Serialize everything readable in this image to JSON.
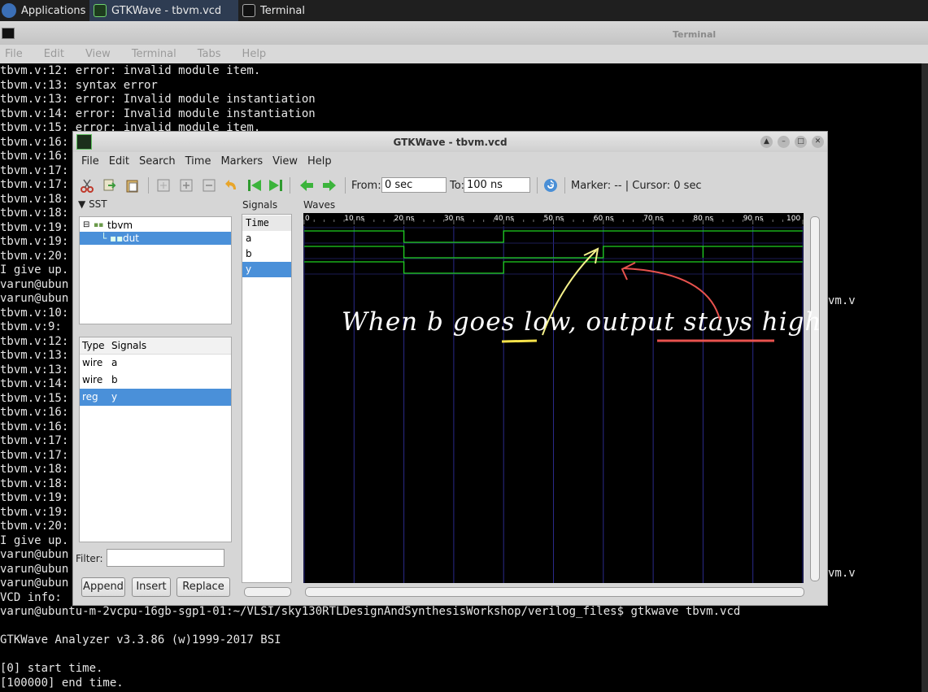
{
  "taskbar": {
    "applications": "Applications",
    "gtkwave_task": "GTKWave - tbvm.vcd",
    "terminal_task": "Terminal"
  },
  "terminal": {
    "title": "Terminal",
    "menu": [
      "File",
      "Edit",
      "View",
      "Terminal",
      "Tabs",
      "Help"
    ],
    "lines": [
      "tbvm.v:12: error: invalid module item.",
      "tbvm.v:13: syntax error",
      "tbvm.v:13: error: Invalid module instantiation",
      "tbvm.v:14: error: Invalid module instantiation",
      "tbvm.v:15: error: invalid module item.",
      "tbvm.v:16:",
      "tbvm.v:16:",
      "tbvm.v:17:",
      "tbvm.v:17:",
      "tbvm.v:18:",
      "tbvm.v:18:",
      "tbvm.v:19:",
      "tbvm.v:19:",
      "tbvm.v:20:",
      "I give up.",
      "varun@ubun",
      "varun@ubun",
      "tbvm.v:10:",
      "tbvm.v:9:",
      "tbvm.v:12:",
      "tbvm.v:13:",
      "tbvm.v:13:",
      "tbvm.v:14:",
      "tbvm.v:15:",
      "tbvm.v:16:",
      "tbvm.v:16:",
      "tbvm.v:17:",
      "tbvm.v:17:",
      "tbvm.v:18:",
      "tbvm.v:18:",
      "tbvm.v:19:",
      "tbvm.v:19:",
      "tbvm.v:20:",
      "I give up.",
      "varun@ubun",
      "varun@ubun",
      "varun@ubun",
      "VCD info:",
      "varun@ubuntu-m-2vcpu-16gb-sgp1-01:~/VLSI/sky130RTLDesignAndSynthesisWorkshop/verilog_files$ gtkwave tbvm.vcd",
      "",
      "GTKWave Analyzer v3.3.86 (w)1999-2017 BSI",
      "",
      "[0] start time.",
      "[100000] end time."
    ],
    "right_fragments": [
      "vm.v",
      "vm.v"
    ]
  },
  "gtkwave": {
    "title": "GTKWave - tbvm.vcd",
    "menu": [
      "File",
      "Edit",
      "Search",
      "Time",
      "Markers",
      "View",
      "Help"
    ],
    "from_label": "From:",
    "from_value": "0 sec",
    "to_label": "To:",
    "to_value": "100 ns",
    "marker_cursor": "Marker: --  |  Cursor: 0 sec",
    "sst_header": "SST",
    "tree": {
      "root": "tbvm",
      "child": "dut"
    },
    "type_signal_header": {
      "type": "Type",
      "signals": "Signals"
    },
    "type_rows": [
      {
        "type": "wire",
        "name": "a"
      },
      {
        "type": "wire",
        "name": "b"
      },
      {
        "type": "reg",
        "name": "y"
      }
    ],
    "filter_label": "Filter:",
    "buttons": {
      "append": "Append",
      "insert": "Insert",
      "replace": "Replace"
    },
    "signals_header": "Signals",
    "signal_rows": [
      "Time",
      "a",
      "b",
      "y"
    ],
    "waves_header": "Waves",
    "time_ticks": [
      "0",
      "10 ns",
      "20 ns",
      "30 ns",
      "40 ns",
      "50 ns",
      "60 ns",
      "70 ns",
      "80 ns",
      "90 ns",
      "100"
    ],
    "waveforms": {
      "a": [
        [
          0,
          1
        ],
        [
          20,
          0
        ],
        [
          40,
          1
        ]
      ],
      "b": [
        [
          0,
          1
        ],
        [
          20,
          0
        ],
        [
          60,
          1
        ],
        [
          80,
          0
        ],
        [
          80,
          1
        ]
      ],
      "y": [
        [
          0,
          1
        ],
        [
          20,
          0
        ],
        [
          40,
          1
        ]
      ]
    },
    "wave_color": "#1fd11f"
  },
  "annotation": {
    "text": "When b goes low, output stays high",
    "arrow1_color": "#f4f08a",
    "arrow2_color": "#e8524e",
    "underline_low_color": "#f6e24a",
    "underline_stays_color": "#e8524e"
  }
}
